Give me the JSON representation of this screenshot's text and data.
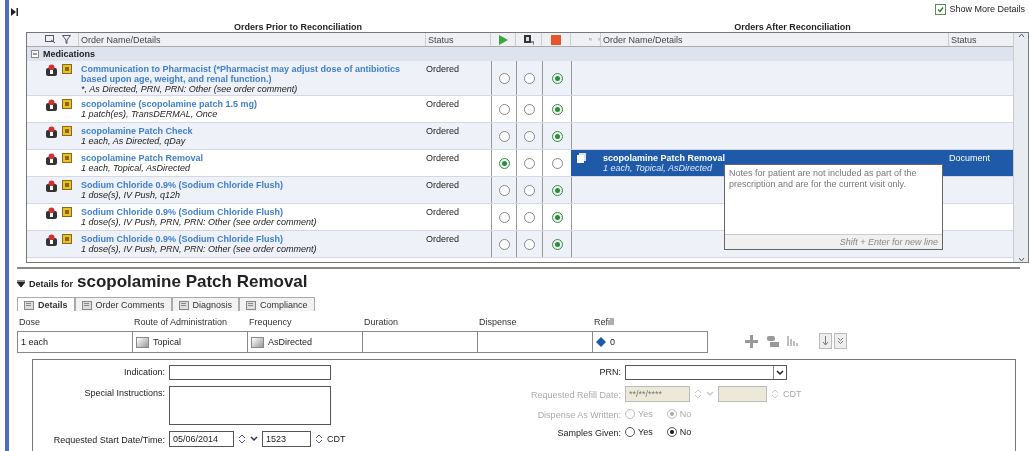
{
  "show_more_details": {
    "label": "Show More Details",
    "checked": true
  },
  "prior": {
    "title": "Orders Prior to Reconciliation",
    "columns": [
      "Order Name/Details",
      "Status"
    ]
  },
  "after": {
    "title": "Orders After Reconciliation",
    "columns": [
      "Order Name/Details",
      "Status"
    ]
  },
  "group": {
    "label": "Medications",
    "expanded": true
  },
  "orders": [
    {
      "name": "Communication to Pharmacist (*Pharmacist may adjust dose of antibiotics based upon age, weight, and renal function.)",
      "details": "*, As Directed, PRN, PRN: Other (see order comment)",
      "status": "Ordered",
      "choices": [
        {
          "selected": false
        },
        {
          "selected": false
        },
        {
          "selected": true
        }
      ]
    },
    {
      "name": "scopolamine (scopolamine patch 1.5 mg)",
      "details": "1 patch(es), TransDERMAL, Once",
      "status": "Ordered",
      "choices": [
        {
          "selected": false
        },
        {
          "selected": false
        },
        {
          "selected": true
        }
      ]
    },
    {
      "name": "scopolamine Patch Check",
      "details": "1 each, As Directed, qDay",
      "status": "Ordered",
      "choices": [
        {
          "selected": false
        },
        {
          "selected": false
        },
        {
          "selected": true
        }
      ]
    },
    {
      "name": "scopolamine Patch Removal",
      "details": "1 each, Topical, AsDirected",
      "status": "Ordered",
      "choices": [
        {
          "selected": true
        },
        {
          "selected": false
        },
        {
          "selected": false
        }
      ],
      "after": {
        "name": "scopolamine Patch Removal",
        "details": "1 each, Topical, AsDirected",
        "status": "Document",
        "selected": true
      }
    },
    {
      "name": "Sodium Chloride 0.9% (Sodium Chloride Flush)",
      "details": "1 dose(s), IV Push, q12h",
      "status": "Ordered",
      "choices": [
        {
          "selected": false
        },
        {
          "selected": false
        },
        {
          "selected": true
        }
      ]
    },
    {
      "name": "Sodium Chloride 0.9% (Sodium Chloride Flush)",
      "details": "1 dose(s), IV Push, PRN, PRN: Other (see order comment)",
      "status": "Ordered",
      "choices": [
        {
          "selected": false
        },
        {
          "selected": false
        },
        {
          "selected": true
        }
      ]
    },
    {
      "name": "Sodium Chloride 0.9% (Sodium Chloride Flush)",
      "details": "1 dose(s), IV Push, PRN, PRN: Other (see order comment)",
      "status": "Ordered",
      "choices": [
        {
          "selected": false
        },
        {
          "selected": false
        },
        {
          "selected": true
        }
      ]
    }
  ],
  "note_popup": {
    "text": "Notes for patient are not included as part of the prescription and are for the current visit only.",
    "hint": "Shift + Enter for new line"
  },
  "details": {
    "prefix": "Details for",
    "name": "scopolamine Patch Removal",
    "tabs": [
      {
        "label": "Details",
        "selected": true
      },
      {
        "label": "Order Comments",
        "selected": false
      },
      {
        "label": "Diagnosis",
        "selected": false
      },
      {
        "label": "Compliance",
        "selected": false
      }
    ],
    "fields": [
      {
        "label": "Dose",
        "value": "1 each",
        "kind": "text"
      },
      {
        "label": "Route of Administration",
        "value": "Topical",
        "kind": "lookup"
      },
      {
        "label": "Frequency",
        "value": "AsDirected",
        "kind": "lookup"
      },
      {
        "label": "Duration",
        "kind": "text"
      },
      {
        "label": "Dispense",
        "kind": "text"
      },
      {
        "label": "Refill",
        "value": "0",
        "kind": "refill"
      }
    ]
  },
  "form": {
    "indication": {
      "label": "Indication:"
    },
    "special_instructions": {
      "label": "Special Instructions:"
    },
    "start": {
      "label": "Requested Start Date/Time:",
      "date": "05/06/2014",
      "time": "1523",
      "zone": "CDT"
    },
    "prn": {
      "label": "PRN:"
    },
    "refill_date": {
      "label": "Requested Refill Date:",
      "placeholder": "**/**/****",
      "zone": "CDT",
      "disabled": true
    },
    "dispense_as_written": {
      "label": "Dispense As Written:",
      "disabled": true,
      "options": [
        {
          "label": "Yes",
          "selected": false
        },
        {
          "label": "No",
          "selected": true
        }
      ]
    },
    "samples_given": {
      "label": "Samples Given:",
      "disabled": false,
      "options": [
        {
          "label": "Yes",
          "selected": false
        },
        {
          "label": "No",
          "selected": true
        }
      ]
    }
  }
}
